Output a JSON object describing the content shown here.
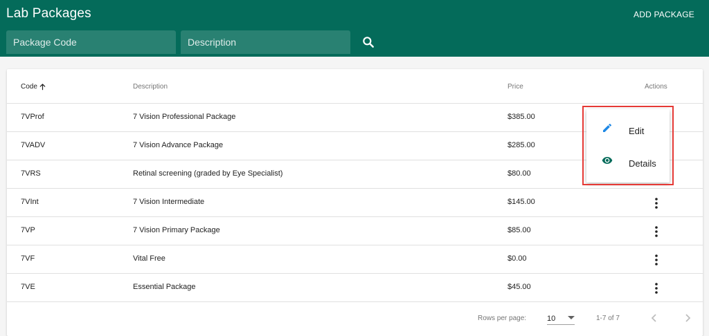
{
  "header": {
    "title": "Lab Packages",
    "add_label": "ADD PACKAGE",
    "code_placeholder": "Package Code",
    "desc_placeholder": "Description",
    "search_icon": "search-icon"
  },
  "table": {
    "columns": {
      "code": "Code",
      "description": "Description",
      "price": "Price",
      "actions": "Actions"
    },
    "sort": "ascending",
    "rows": [
      {
        "code": "7VProf",
        "description": "7 Vision Professional Package",
        "price": "$385.00"
      },
      {
        "code": "7VADV",
        "description": "7 Vision Advance Package",
        "price": "$285.00"
      },
      {
        "code": "7VRS",
        "description": "Retinal screening (graded by Eye Specialist)",
        "price": "$80.00"
      },
      {
        "code": "7VInt",
        "description": "7 Vision Intermediate",
        "price": "$145.00"
      },
      {
        "code": "7VP",
        "description": "7 Vision Primary Package",
        "price": "$85.00"
      },
      {
        "code": "7VF",
        "description": "Vital Free",
        "price": "$0.00"
      },
      {
        "code": "7VE",
        "description": "Essential Package",
        "price": "$45.00"
      }
    ]
  },
  "pagination": {
    "rows_per_page_label": "Rows per page:",
    "rows_per_page": "10",
    "range": "1-7 of 7"
  },
  "menu": {
    "edit_label": "Edit",
    "details_label": "Details"
  },
  "colors": {
    "primary": "#046b5a",
    "edit_icon": "#1e88e5",
    "details_icon": "#046b5a",
    "highlight": "#e53935"
  }
}
